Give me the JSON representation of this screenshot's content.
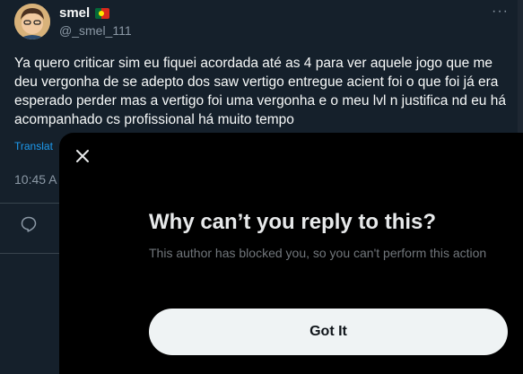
{
  "tweet": {
    "author_name": "smel",
    "author_handle": "@_smel_111",
    "more_label": "···",
    "text": "Ya quero criticar sim eu fiquei acordada até as 4 para ver aquele jogo que me deu vergonha de se adepto dos saw vertigo entregue acient foi o que foi já era esperado perder mas a vertigo foi uma vergonha e o meu lvl n justifica nd eu há acompanhado cs profissional há muito tempo",
    "translate_label": "Translat",
    "time": "10:45 A",
    "icons": [
      "portugal-flag-icon",
      "more-icon",
      "reply-icon"
    ]
  },
  "modal": {
    "title": "Why can’t you reply to this?",
    "description": "This author has blocked you, so you can't perform this action",
    "button_label": "Got It",
    "close_icon": "close-icon"
  },
  "colors": {
    "background": "#15202b",
    "modal_background": "#000000",
    "link": "#1d9bf0",
    "secondary_text": "#8b98a5",
    "button_bg": "#eff3f4"
  }
}
